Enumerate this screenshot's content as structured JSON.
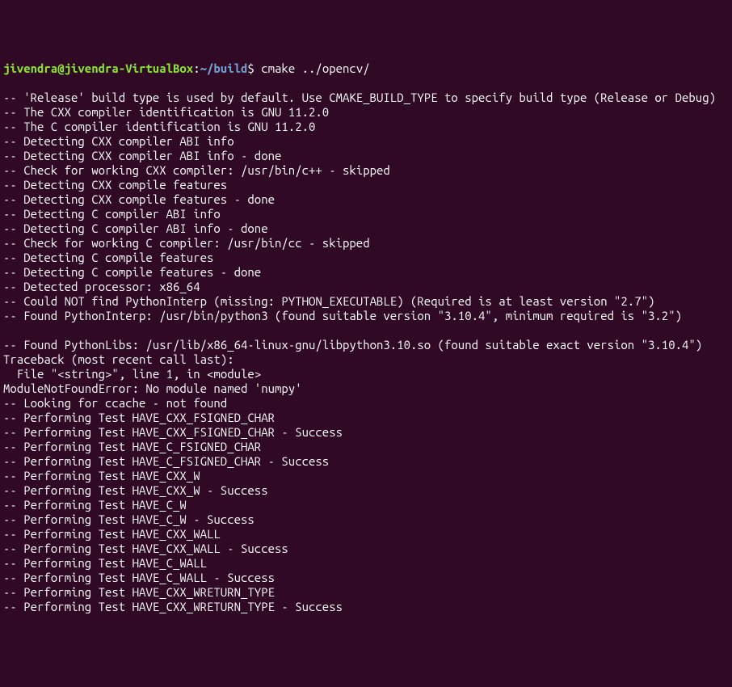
{
  "prompt": {
    "user_host": "jivendra@jivendra-VirtualBox",
    "colon": ":",
    "path": "~/build",
    "dollar": "$",
    "command": "cmake ../opencv/"
  },
  "lines": [
    "-- 'Release' build type is used by default. Use CMAKE_BUILD_TYPE to specify build type (Release or Debug)",
    "-- The CXX compiler identification is GNU 11.2.0",
    "-- The C compiler identification is GNU 11.2.0",
    "-- Detecting CXX compiler ABI info",
    "-- Detecting CXX compiler ABI info - done",
    "-- Check for working CXX compiler: /usr/bin/c++ - skipped",
    "-- Detecting CXX compile features",
    "-- Detecting CXX compile features - done",
    "-- Detecting C compiler ABI info",
    "-- Detecting C compiler ABI info - done",
    "-- Check for working C compiler: /usr/bin/cc - skipped",
    "-- Detecting C compile features",
    "-- Detecting C compile features - done",
    "-- Detected processor: x86_64",
    "-- Could NOT find PythonInterp (missing: PYTHON_EXECUTABLE) (Required is at least version \"2.7\")",
    "-- Found PythonInterp: /usr/bin/python3 (found suitable version \"3.10.4\", minimum required is \"3.2\")",
    "",
    "-- Found PythonLibs: /usr/lib/x86_64-linux-gnu/libpython3.10.so (found suitable exact version \"3.10.4\")",
    "Traceback (most recent call last):",
    "  File \"<string>\", line 1, in <module>",
    "ModuleNotFoundError: No module named 'numpy'",
    "-- Looking for ccache - not found",
    "-- Performing Test HAVE_CXX_FSIGNED_CHAR",
    "-- Performing Test HAVE_CXX_FSIGNED_CHAR - Success",
    "-- Performing Test HAVE_C_FSIGNED_CHAR",
    "-- Performing Test HAVE_C_FSIGNED_CHAR - Success",
    "-- Performing Test HAVE_CXX_W",
    "-- Performing Test HAVE_CXX_W - Success",
    "-- Performing Test HAVE_C_W",
    "-- Performing Test HAVE_C_W - Success",
    "-- Performing Test HAVE_CXX_WALL",
    "-- Performing Test HAVE_CXX_WALL - Success",
    "-- Performing Test HAVE_C_WALL",
    "-- Performing Test HAVE_C_WALL - Success",
    "-- Performing Test HAVE_CXX_WRETURN_TYPE",
    "-- Performing Test HAVE_CXX_WRETURN_TYPE - Success"
  ]
}
